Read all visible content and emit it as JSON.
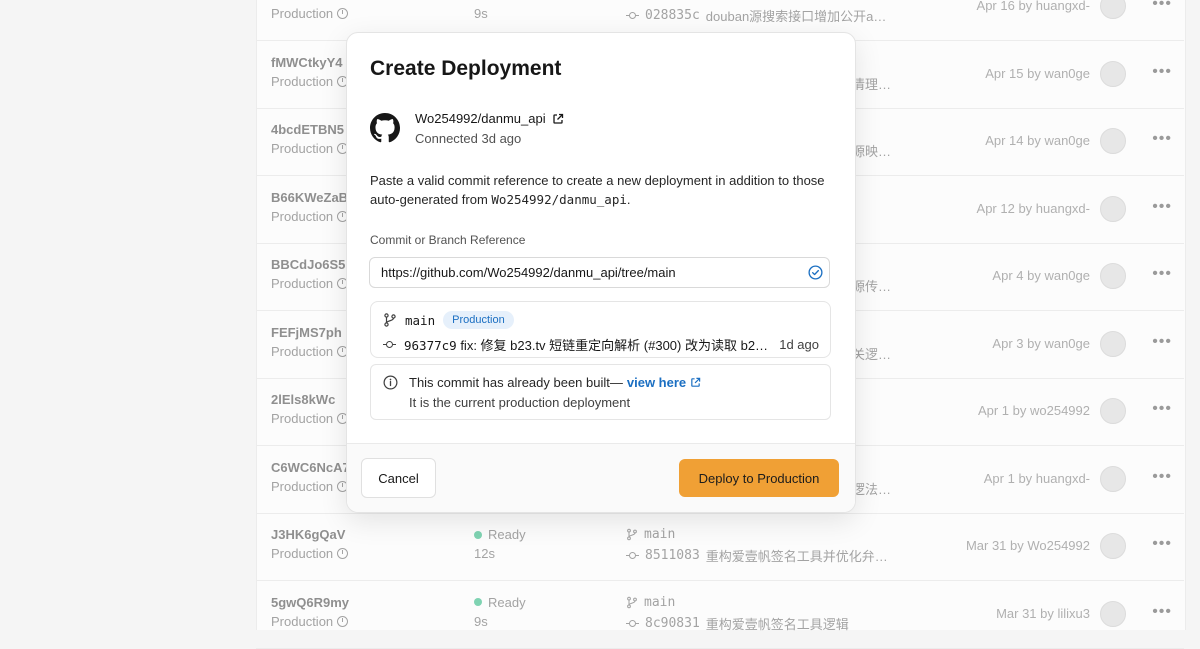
{
  "background_list": {
    "rows": [
      {
        "id": "",
        "environment": "Production",
        "status": "",
        "duration": "9s",
        "branch": "",
        "commit_hash": "028835c",
        "commit_message": "douban源搜索接口增加公开a…",
        "meta": "Apr 16 by huangxd-"
      },
      {
        "id": "fMWCtkyY4",
        "environment": "Production",
        "status": "",
        "duration": "",
        "branch": "",
        "commit_hash": "",
        "commit_message": "清理…",
        "meta": "Apr 15 by wan0ge"
      },
      {
        "id": "4bcdETBN5",
        "environment": "Production",
        "status": "",
        "duration": "",
        "branch": "",
        "commit_hash": "",
        "commit_message": "源映…",
        "meta": "Apr 14 by wan0ge"
      },
      {
        "id": "B66KWeZaB",
        "environment": "Production",
        "status": "",
        "duration": "",
        "branch": "",
        "commit_hash": "",
        "commit_message": "",
        "meta": "Apr 12 by huangxd-"
      },
      {
        "id": "BBCdJo6S5",
        "environment": "Production",
        "status": "",
        "duration": "",
        "branch": "",
        "commit_hash": "",
        "commit_message": "源传…",
        "meta": "Apr 4 by wan0ge"
      },
      {
        "id": "FEFjMS7ph",
        "environment": "Production",
        "status": "",
        "duration": "",
        "branch": "",
        "commit_hash": "",
        "commit_message": "关逻…",
        "meta": "Apr 3 by wan0ge"
      },
      {
        "id": "2lEls8kWc",
        "environment": "Production",
        "status": "",
        "duration": "",
        "branch": "",
        "commit_hash": "",
        "commit_message": "",
        "meta": "Apr 1 by wo254992"
      },
      {
        "id": "C6WC6NcA7",
        "environment": "Production",
        "status": "",
        "duration": "",
        "branch": "",
        "commit_hash": "",
        "commit_message": "逻法…",
        "meta": "Apr 1 by huangxd-"
      },
      {
        "id": "J3HK6gQaV",
        "environment": "Production",
        "status": "Ready",
        "duration": "12s",
        "branch": "main",
        "commit_hash": "8511083",
        "commit_message": "重构爱壹帆签名工具并优化弁…",
        "meta": "Mar 31 by Wo254992"
      },
      {
        "id": "5gwQ6R9my",
        "environment": "Production",
        "status": "Ready",
        "duration": "9s",
        "branch": "main",
        "commit_hash": "8c90831",
        "commit_message": "重构爱壹帆签名工具逻辑",
        "meta": "Mar 31 by lilixu3"
      }
    ],
    "more_label": "•••"
  },
  "modal": {
    "title": "Create Deployment",
    "repo": {
      "name": "Wo254992/danmu_api",
      "connected": "Connected 3d ago"
    },
    "description_pre": "Paste a valid commit reference to create a new deployment in addition to those auto-generated from ",
    "description_repo": "Wo254992/danmu_api",
    "description_post": ".",
    "field_label": "Commit or Branch Reference",
    "field_value": "https://github.com/Wo254992/danmu_api/tree/main",
    "ref": {
      "branch": "main",
      "badge": "Production",
      "commit_hash": "96377c9",
      "commit_message": "fix: 修复 b23.tv 短链重定向解析 (#300) 改为读取 b2…",
      "commit_age": "1d ago"
    },
    "info": {
      "line1_text": "This commit has already been built—",
      "link_text": "view here",
      "line2_text": "It is the current production deployment"
    },
    "buttons": {
      "cancel": "Cancel",
      "deploy": "Deploy to Production"
    }
  },
  "colors": {
    "accent": "#f0a035",
    "link": "#1b6fc2",
    "badge_bg": "#e6f0fb",
    "ready": "#7fd3b2"
  }
}
